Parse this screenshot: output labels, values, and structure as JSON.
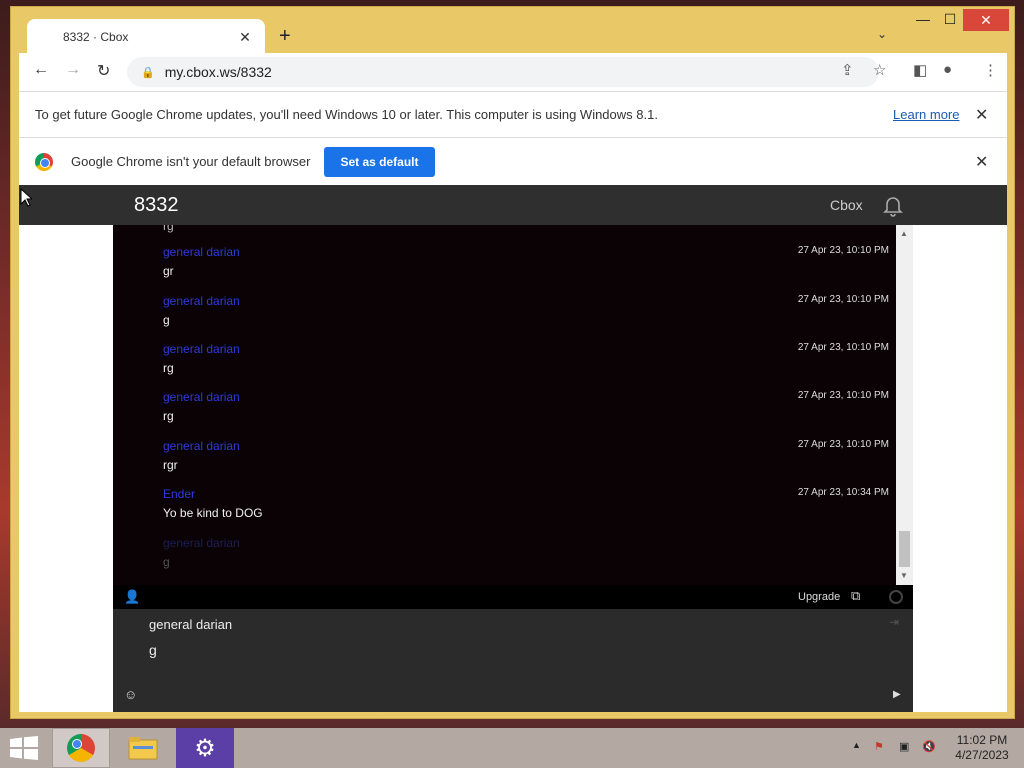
{
  "browser": {
    "tab_title": "8332 · Cbox",
    "url": "my.cbox.ws/8332"
  },
  "infobar_update": {
    "message": "To get future Google Chrome updates, you'll need Windows 10 or later. This computer is using Windows 8.1.",
    "link": "Learn more"
  },
  "infobar_default": {
    "message": "Google Chrome isn't your default browser",
    "button": "Set as default"
  },
  "site": {
    "title": "8332",
    "brand": "Cbox"
  },
  "messages": [
    {
      "author": "general darian",
      "text": "gr",
      "time": "27 Apr 23, 10:10 PM"
    },
    {
      "author": "general darian",
      "text": "g",
      "time": "27 Apr 23, 10:10 PM"
    },
    {
      "author": "general darian",
      "text": "rg",
      "time": "27 Apr 23, 10:10 PM"
    },
    {
      "author": "general darian",
      "text": "rg",
      "time": "27 Apr 23, 10:10 PM"
    },
    {
      "author": "general darian",
      "text": "rgr",
      "time": "27 Apr 23, 10:10 PM"
    },
    {
      "author": "Ender",
      "text": "Yo be kind to DOG",
      "time": "27 Apr 23, 10:34 PM"
    },
    {
      "author": "general darian",
      "text": "g",
      "time": ""
    }
  ],
  "chat_bar": {
    "upgrade": "Upgrade"
  },
  "composer": {
    "name": "general darian",
    "value": "g"
  },
  "clock": {
    "time": "11:02 PM",
    "date": "4/27/2023"
  },
  "colors": {
    "window_frame": "#e9c867",
    "author_link": "#2f3bdb",
    "chat_bg": "#0a0204",
    "set_default_button": "#1a73e8"
  }
}
